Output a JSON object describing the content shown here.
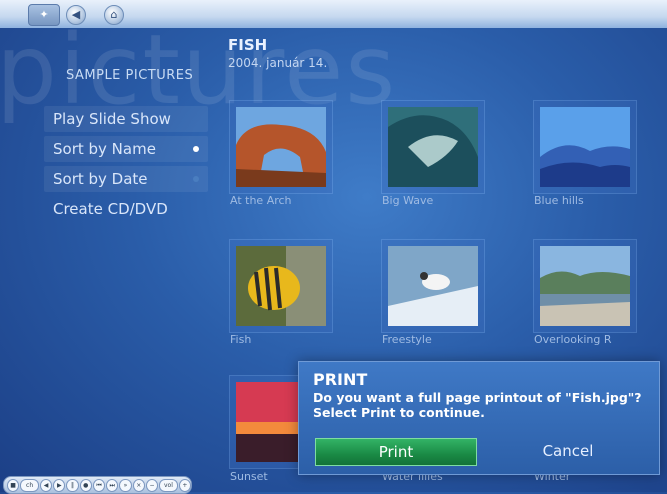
{
  "topbar": {
    "logo_icon": "media-center-logo-icon",
    "back_icon": "back-arrow-icon",
    "home_icon": "home-icon"
  },
  "watermark": "pictures",
  "section_title": "SAMPLE PICTURES",
  "folder": {
    "title": "FISH",
    "date": "2004. január 14."
  },
  "menu": {
    "items": [
      {
        "label": "Play Slide Show",
        "selected": true
      },
      {
        "label": "Sort by Name",
        "radio": "on"
      },
      {
        "label": "Sort by Date",
        "radio": "off"
      },
      {
        "label": "Create CD/DVD"
      }
    ]
  },
  "thumbnails": [
    {
      "caption": "At the Arch"
    },
    {
      "caption": "Big Wave"
    },
    {
      "caption": "Blue hills"
    },
    {
      "caption": "Fish"
    },
    {
      "caption": "Freestyle"
    },
    {
      "caption": "Overlooking R"
    },
    {
      "caption": "Sunset"
    },
    {
      "caption": "Water lilies"
    },
    {
      "caption": "Winter"
    }
  ],
  "dialog": {
    "title": "PRINT",
    "message": "Do you want a full page printout of \"Fish.jpg\"? Select Print to continue.",
    "print_label": "Print",
    "cancel_label": "Cancel"
  },
  "transport": {
    "buttons": [
      "stop",
      "pause",
      "play",
      "record",
      "skip-back",
      "rewind",
      "fast-forward",
      "skip-forward",
      "vol-down",
      "mute",
      "vol-up",
      "channel"
    ],
    "labels": [
      "ch",
      "vol"
    ]
  },
  "colors": {
    "accent": "#1a8a45",
    "background": "#2a5da9",
    "dialog": "#3f79c6"
  }
}
